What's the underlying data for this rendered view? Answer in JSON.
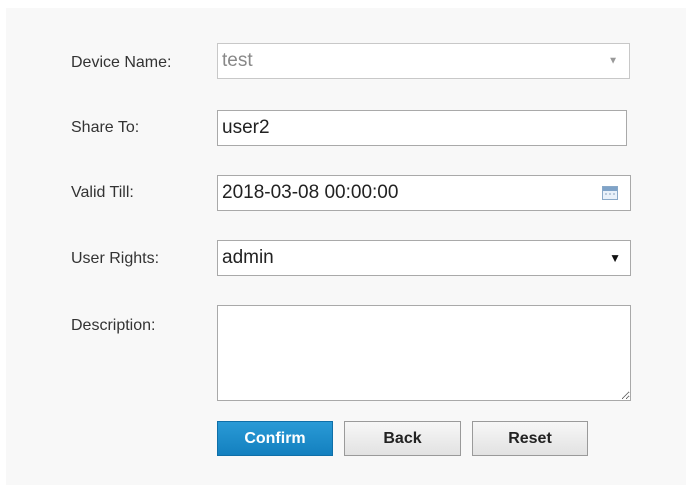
{
  "form": {
    "device_name": {
      "label": "Device Name:",
      "value": "test"
    },
    "share_to": {
      "label": "Share To:",
      "value": "user2"
    },
    "valid_till": {
      "label": "Valid Till:",
      "value": "2018-03-08 00:00:00"
    },
    "user_rights": {
      "label": "User Rights:",
      "value": "admin"
    },
    "description": {
      "label": "Description:",
      "value": ""
    }
  },
  "buttons": {
    "confirm": "Confirm",
    "back": "Back",
    "reset": "Reset"
  },
  "icons": {
    "device_dropdown": "chevron-down-icon",
    "calendar": "calendar-icon",
    "rights_dropdown": "chevron-down-icon"
  },
  "colors": {
    "primary_button": "#1a8ccc",
    "panel_background": "#f8f8f8"
  }
}
